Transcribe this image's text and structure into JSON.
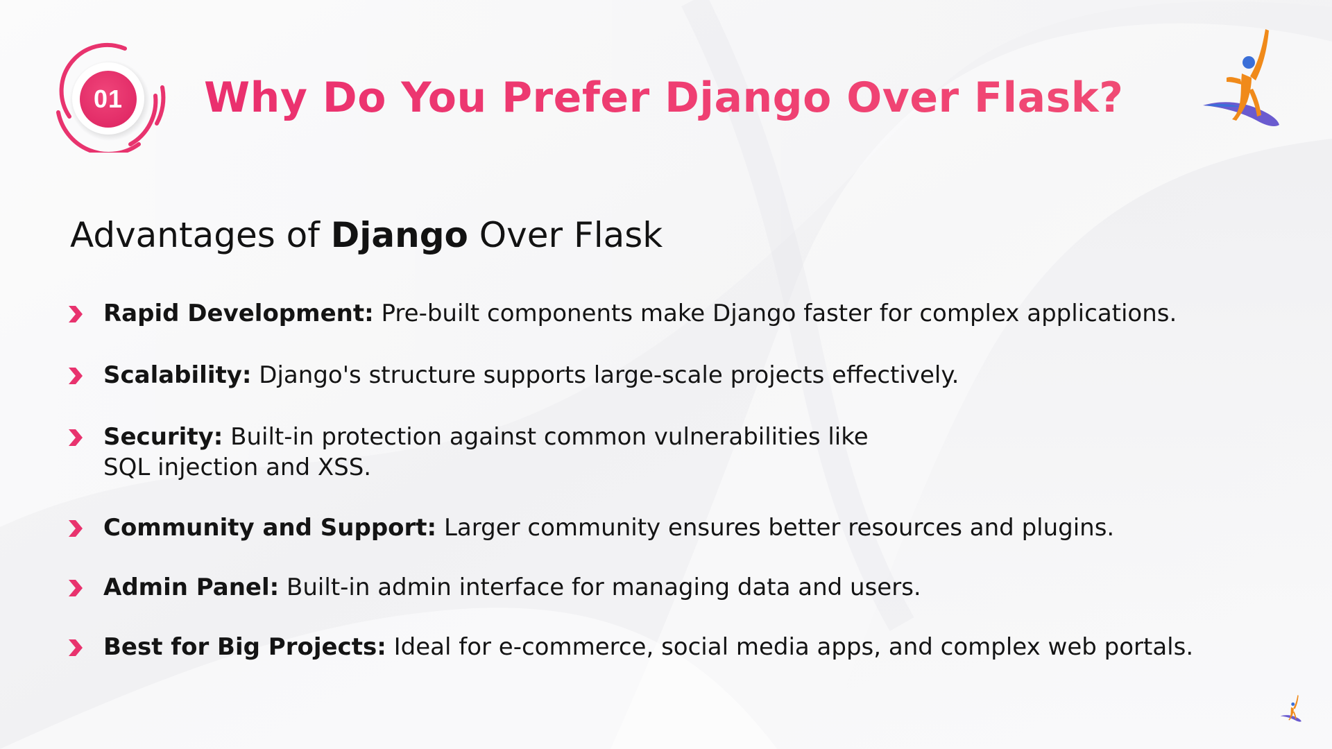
{
  "header": {
    "badge_number": "01",
    "title": "Why Do You Prefer Django Over Flask?"
  },
  "subtitle": {
    "part1": "Advantages of ",
    "bold": "Django",
    "part2": " Over Flask"
  },
  "bullets": [
    {
      "label": "Rapid Development:",
      "text": " Pre-built components make Django faster for complex applications."
    },
    {
      "label": "Scalability:",
      "text": " Django's structure supports large-scale projects effectively."
    },
    {
      "label": "Security:",
      "text_line1": " Built-in protection against common vulnerabilities like",
      "text_line2": "SQL injection and XSS."
    },
    {
      "label": "Community and Support:",
      "text": " Larger community ensures better resources and plugins."
    },
    {
      "label": "Admin Panel:",
      "text": " Built-in admin interface for managing data and users."
    },
    {
      "label": "Best for Big Projects:",
      "text": " Ideal for e-commerce, social media apps, and complex web portals."
    }
  ],
  "colors": {
    "accent": "#e9336f",
    "text": "#121212",
    "logo_orange": "#f08a1a",
    "logo_purple": "#6a5acd",
    "logo_blue": "#3b6fd8"
  },
  "icons": {
    "badge": "numbered-ring-badge",
    "bullet": "chevron-right-icon",
    "logo": "jumping-person-logo"
  }
}
